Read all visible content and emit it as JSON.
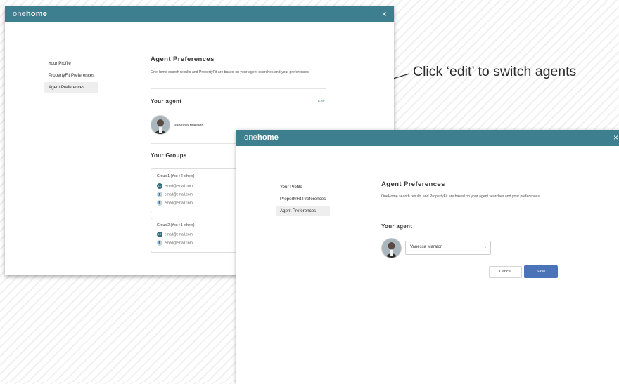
{
  "callout": {
    "text": "Click ‘edit’ to switch agents"
  },
  "window1": {
    "logo_light": "one",
    "logo_bold": "home",
    "close_glyph": "×",
    "nav": [
      {
        "label": "Your Profile"
      },
      {
        "label": "PropertyFit Preferences"
      },
      {
        "label": "Agent Preferences"
      }
    ],
    "title": "Agent Preferences",
    "description": "OneHome search results and PropertyFit are based on your agent searches and your preferences.",
    "your_agent_heading": "Your agent",
    "edit_label": "Edit",
    "agent_name": "Vanessa Maralon",
    "groups_heading": "Your Groups",
    "groups": [
      {
        "title": "Group 1 (You +2 others)",
        "emails": [
          {
            "badge": "LC",
            "email": "email@email.com",
            "style": "dark"
          },
          {
            "badge": "",
            "email": "email@email.com",
            "style": "light"
          },
          {
            "badge": "",
            "email": "email@email.com",
            "style": "light"
          }
        ]
      },
      {
        "title": "Group 2 (You +1 others)",
        "emails": [
          {
            "badge": "LC",
            "email": "email@email.com",
            "style": "dark"
          },
          {
            "badge": "",
            "email": "email@email.com",
            "style": "light"
          }
        ]
      }
    ]
  },
  "window2": {
    "logo_light": "one",
    "logo_bold": "home",
    "close_glyph": "×",
    "nav": [
      {
        "label": "Your Profile"
      },
      {
        "label": "PropertyFit Preferences"
      },
      {
        "label": "Agent Preferences"
      }
    ],
    "title": "Agent Preferences",
    "description": "OneHome search results and PropertyFit are based on your agent searches and your preferences.",
    "your_agent_heading": "Your agent",
    "agent_select_value": "Vanessa Maralon",
    "chevron_glyph": "⌄",
    "cancel_label": "Cancel",
    "save_label": "Save"
  },
  "colors": {
    "header_teal": "#3d7f8e",
    "save_blue": "#4a73b8",
    "edit_link": "#3d7f8e"
  },
  "icons": {
    "close": "close-icon",
    "chevron": "chevron-down-icon",
    "avatar": "agent-avatar",
    "user": "user-icon"
  }
}
